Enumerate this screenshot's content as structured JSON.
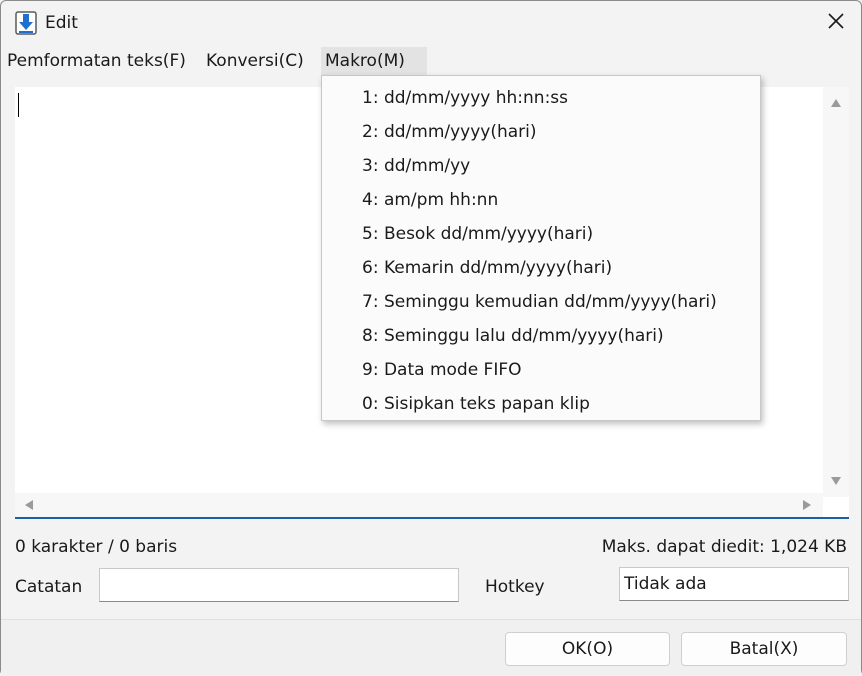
{
  "window": {
    "title": "Edit"
  },
  "menu": {
    "items": [
      "Pemformatan teks(F)",
      "Konversi(C)",
      "Makro(M)"
    ]
  },
  "macro_menu": {
    "items": [
      "1: dd/mm/yyyy hh:nn:ss",
      "2: dd/mm/yyyy(hari)",
      "3: dd/mm/yy",
      "4: am/pm hh:nn",
      "5: Besok dd/mm/yyyy(hari)",
      "6: Kemarin dd/mm/yyyy(hari)",
      "7: Seminggu kemudian dd/mm/yyyy(hari)",
      "8: Seminggu lalu dd/mm/yyyy(hari)",
      "9: Data mode FIFO",
      "0: Sisipkan teks papan klip"
    ]
  },
  "status": {
    "count": "0 karakter / 0 baris",
    "max": "Maks. dapat diedit: 1,024 KB"
  },
  "form": {
    "note_label": "Catatan",
    "note_value": "",
    "hotkey_label": "Hotkey",
    "hotkey_value": "Tidak ada"
  },
  "buttons": {
    "ok": "OK(O)",
    "cancel": "Batal(X)"
  },
  "colors": {
    "accent": "#1a5fa8",
    "icon_blue": "#1e6fd0"
  }
}
